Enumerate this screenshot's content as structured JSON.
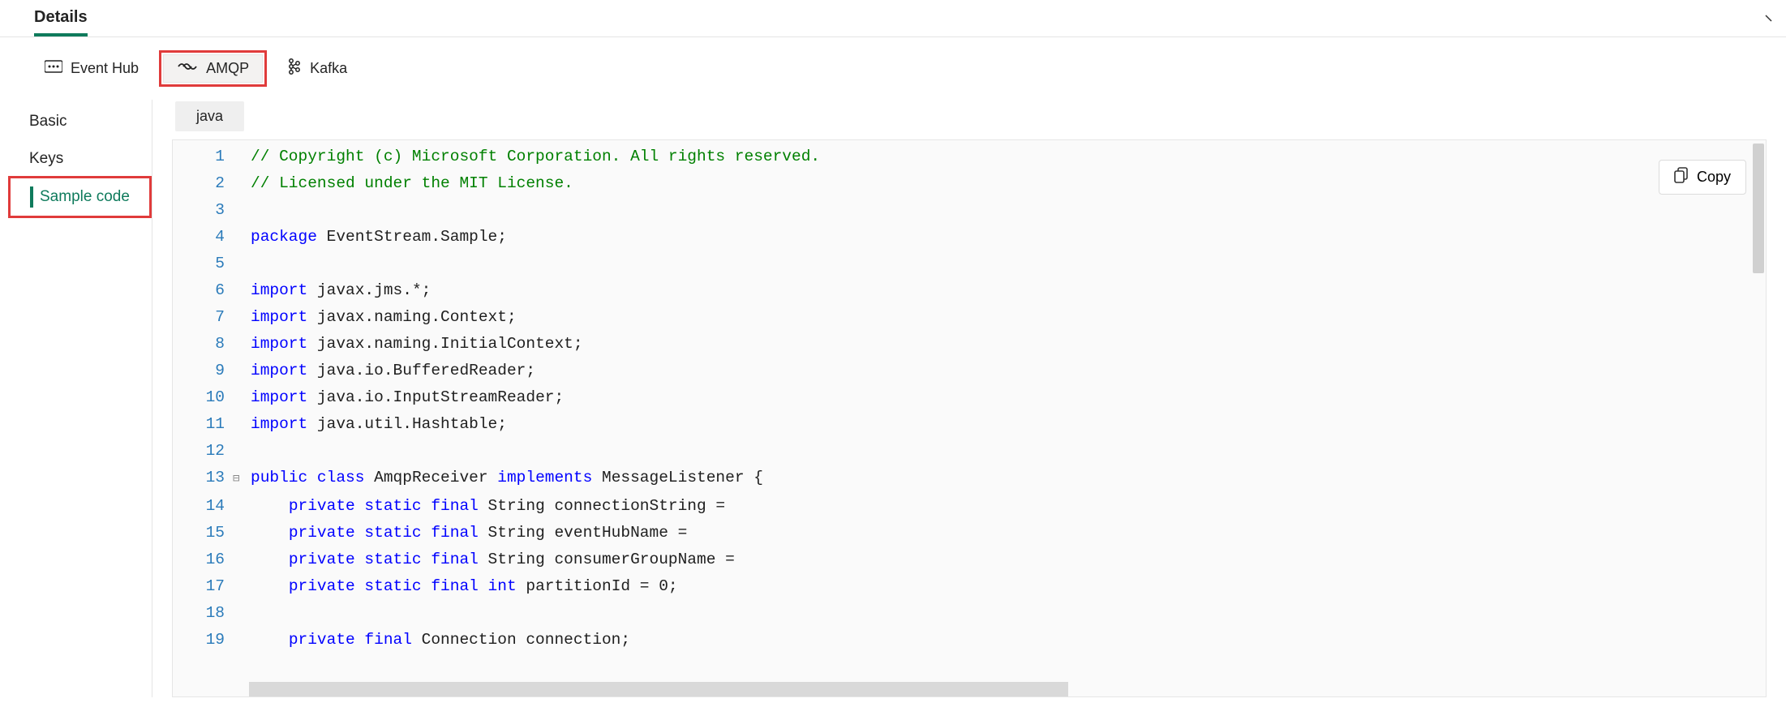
{
  "header": {
    "title": "Details"
  },
  "tabs": {
    "items": [
      {
        "label": "Event Hub"
      },
      {
        "label": "AMQP"
      },
      {
        "label": "Kafka"
      }
    ],
    "active_index": 1
  },
  "sidebar": {
    "items": [
      {
        "label": "Basic"
      },
      {
        "label": "Keys"
      },
      {
        "label": "Sample code"
      }
    ],
    "active_index": 2
  },
  "language_chip": "java",
  "copy_label": "Copy",
  "code": {
    "lines": [
      {
        "n": 1,
        "seg": [
          [
            "c-com",
            "// Copyright (c) Microsoft Corporation. All rights reserved."
          ]
        ]
      },
      {
        "n": 2,
        "seg": [
          [
            "c-com",
            "// Licensed under the MIT License."
          ]
        ]
      },
      {
        "n": 3,
        "seg": []
      },
      {
        "n": 4,
        "seg": [
          [
            "c-kw",
            "package"
          ],
          [
            "c-id",
            " EventStream.Sample;"
          ]
        ]
      },
      {
        "n": 5,
        "seg": []
      },
      {
        "n": 6,
        "seg": [
          [
            "c-kw",
            "import"
          ],
          [
            "c-id",
            " javax.jms.*;"
          ]
        ]
      },
      {
        "n": 7,
        "seg": [
          [
            "c-kw",
            "import"
          ],
          [
            "c-id",
            " javax.naming.Context;"
          ]
        ]
      },
      {
        "n": 8,
        "seg": [
          [
            "c-kw",
            "import"
          ],
          [
            "c-id",
            " javax.naming.InitialContext;"
          ]
        ]
      },
      {
        "n": 9,
        "seg": [
          [
            "c-kw",
            "import"
          ],
          [
            "c-id",
            " java.io.BufferedReader;"
          ]
        ]
      },
      {
        "n": 10,
        "seg": [
          [
            "c-kw",
            "import"
          ],
          [
            "c-id",
            " java.io.InputStreamReader;"
          ]
        ]
      },
      {
        "n": 11,
        "seg": [
          [
            "c-kw",
            "import"
          ],
          [
            "c-id",
            " java.util.Hashtable;"
          ]
        ]
      },
      {
        "n": 12,
        "seg": []
      },
      {
        "n": 13,
        "fold": true,
        "seg": [
          [
            "c-kw",
            "public class"
          ],
          [
            "c-id",
            " AmqpReceiver "
          ],
          [
            "c-kw",
            "implements"
          ],
          [
            "c-id",
            " MessageListener {"
          ]
        ]
      },
      {
        "n": 14,
        "indent": "    ",
        "seg": [
          [
            "c-kw",
            "private static final"
          ],
          [
            "c-id",
            " String connectionString ="
          ]
        ]
      },
      {
        "n": 15,
        "indent": "    ",
        "seg": [
          [
            "c-kw",
            "private static final"
          ],
          [
            "c-id",
            " String eventHubName ="
          ]
        ]
      },
      {
        "n": 16,
        "indent": "    ",
        "seg": [
          [
            "c-kw",
            "private static final"
          ],
          [
            "c-id",
            " String consumerGroupName ="
          ]
        ]
      },
      {
        "n": 17,
        "indent": "    ",
        "seg": [
          [
            "c-kw",
            "private static final int"
          ],
          [
            "c-id",
            " partitionId = 0;"
          ]
        ]
      },
      {
        "n": 18,
        "seg": []
      },
      {
        "n": 19,
        "indent": "    ",
        "seg": [
          [
            "c-kw",
            "private final"
          ],
          [
            "c-id",
            " Connection connection;"
          ]
        ]
      }
    ]
  }
}
